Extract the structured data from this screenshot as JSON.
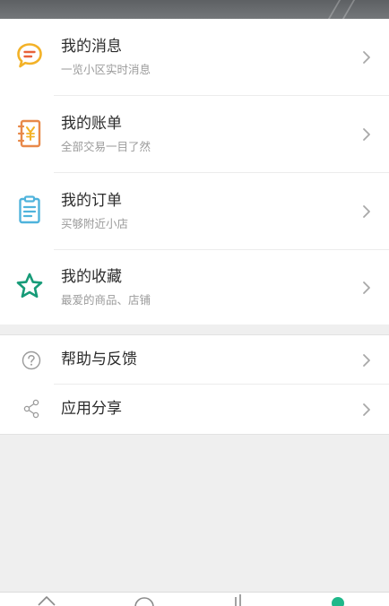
{
  "menu": {
    "messages": {
      "title": "我的消息",
      "subtitle": "一览小区实时消息",
      "icon": "chat-bubble-icon",
      "color": "#f3b228"
    },
    "bills": {
      "title": "我的账单",
      "subtitle": "全部交易一目了然",
      "icon": "ledger-icon",
      "color": "#e8894a"
    },
    "orders": {
      "title": "我的订单",
      "subtitle": "买够附近小店",
      "icon": "clipboard-icon",
      "color": "#4fb3dc"
    },
    "favorites": {
      "title": "我的收藏",
      "subtitle": "最爱的商品、店铺",
      "icon": "star-icon",
      "color": "#179b78"
    }
  },
  "extra": {
    "help": {
      "title": "帮助与反馈",
      "icon": "question-circle-icon",
      "color": "#9a9a9a"
    },
    "share": {
      "title": "应用分享",
      "icon": "share-icon",
      "color": "#9a9a9a"
    }
  },
  "bottom_nav": {
    "items": [
      {
        "icon": "home-icon"
      },
      {
        "icon": "smile-icon"
      },
      {
        "icon": "signal-icon"
      },
      {
        "icon": "profile-icon",
        "active": true,
        "color": "#1fb88a"
      }
    ]
  }
}
